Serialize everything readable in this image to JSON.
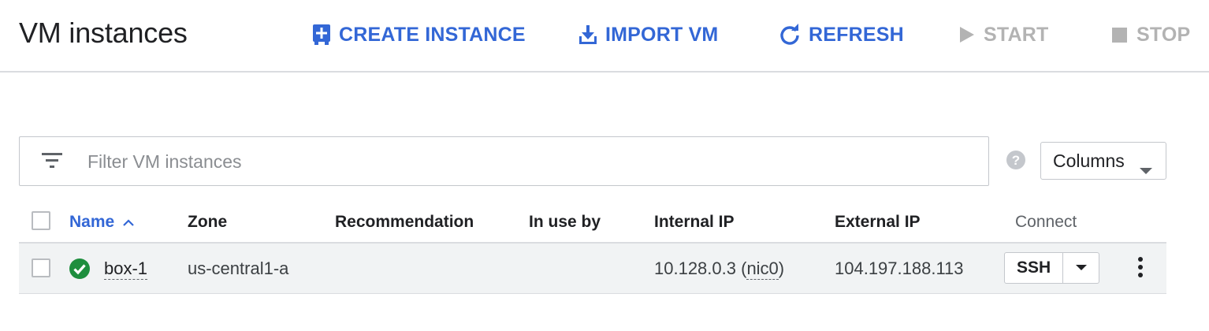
{
  "header": {
    "title": "VM instances",
    "actions": {
      "create": "CREATE INSTANCE",
      "import": "IMPORT VM",
      "refresh": "REFRESH",
      "start": "START",
      "stop": "STOP"
    }
  },
  "filter": {
    "placeholder": "Filter VM instances",
    "value": ""
  },
  "columns_button": "Columns",
  "table": {
    "headers": {
      "name": "Name",
      "zone": "Zone",
      "recommendation": "Recommendation",
      "in_use_by": "In use by",
      "internal_ip": "Internal IP",
      "external_ip": "External IP",
      "connect": "Connect"
    },
    "sort": {
      "column": "Name",
      "direction": "ascending"
    },
    "rows": [
      {
        "status": "running",
        "name": "box-1",
        "zone": "us-central1-a",
        "recommendation": "",
        "in_use_by": "",
        "internal_ip": "10.128.0.3",
        "internal_ip_nic": "nic0",
        "external_ip": "104.197.188.113",
        "connect_label": "SSH"
      }
    ]
  },
  "icons": {
    "create": "add-box-icon",
    "import": "download-icon",
    "refresh": "refresh-icon",
    "start": "play-icon",
    "stop": "stop-icon",
    "filter": "filter-list-icon",
    "help": "help-icon",
    "status": "check-circle-icon",
    "more": "more-vert-icon"
  },
  "colors": {
    "accent": "#3367d6",
    "disabled": "#b3b3b3",
    "status_ok": "#1e8e3e",
    "row_bg": "#f1f3f4"
  }
}
